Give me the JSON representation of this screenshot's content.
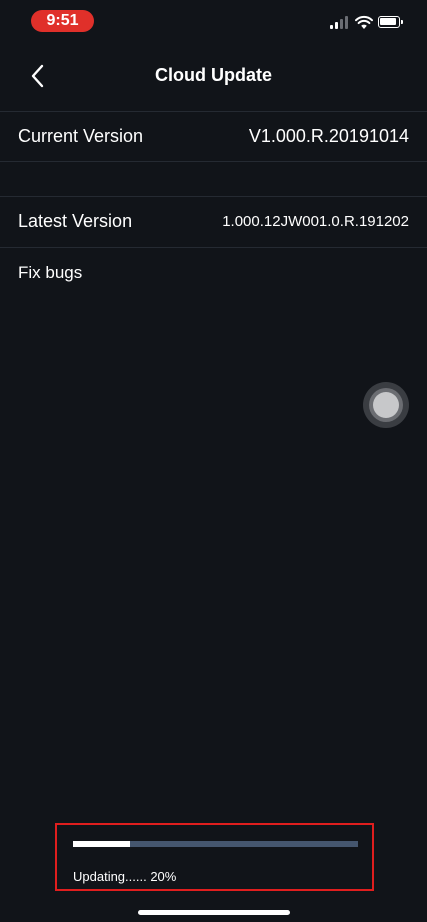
{
  "status_bar": {
    "time": "9:51",
    "signal_icon": "signal-bars-icon",
    "wifi_icon": "wifi-icon",
    "battery_icon": "battery-icon",
    "time_pill_color": "#e0302a"
  },
  "nav": {
    "back_icon": "chevron-left-icon",
    "title": "Cloud Update"
  },
  "current_version": {
    "label": "Current Version",
    "value": "V1.000.R.20191014"
  },
  "latest_version": {
    "label": "Latest Version",
    "value": "1.000.12JW001.0.R.191202"
  },
  "release_notes": "Fix bugs",
  "progress": {
    "status_text": "Updating...... 20%",
    "fraction": 0.2,
    "fill_color": "#ffffff",
    "track_color": "#45566e",
    "highlight_border_color": "#e01e1e"
  },
  "theme": {
    "background": "#111419",
    "divider": "#252a32"
  }
}
